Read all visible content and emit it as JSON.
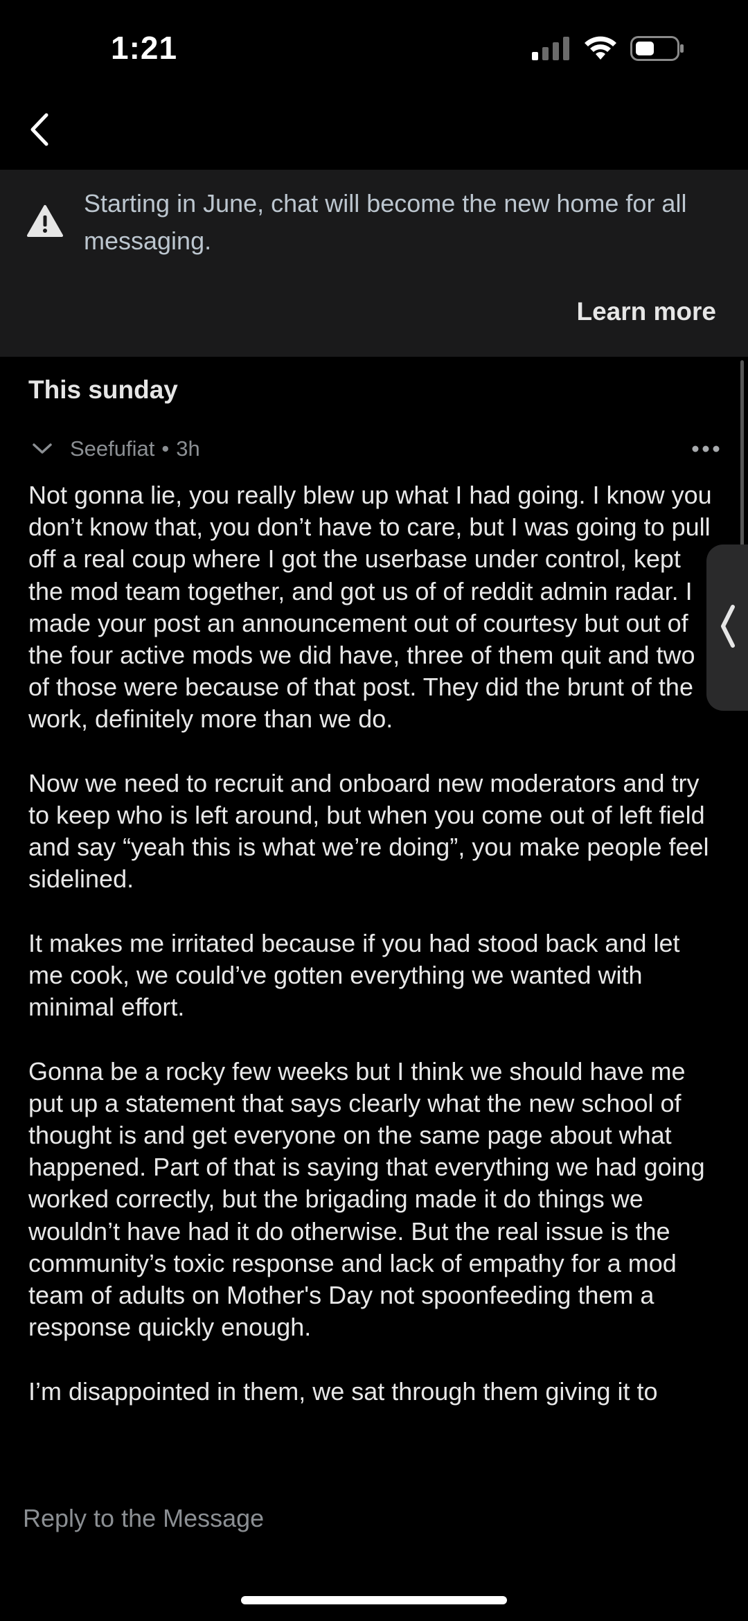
{
  "status_bar": {
    "time": "1:21",
    "icons": [
      "cellular-signal-icon",
      "wifi-icon",
      "battery-icon"
    ]
  },
  "nav": {
    "back_icon": "chevron-left-icon"
  },
  "banner": {
    "icon": "warning-icon",
    "text": "Starting in June, chat will become the new home for all messaging.",
    "link_label": "Learn more"
  },
  "thread": {
    "subject": "This sunday",
    "message": {
      "author": "Seefufiat",
      "separator": "•",
      "time_ago": "3h",
      "paragraphs": [
        "Not gonna lie, you really blew up what I had going. I know you don’t know that, you don’t have to care, but I was going to pull off a real coup where I got the userbase under control, kept the mod team together, and got us of of reddit admin radar. I made your post an announcement out of courtesy but out of the four active mods we did have, three of them quit and two of those were because of that post. They did the brunt of the work, definitely more than we do.",
        "Now we need to recruit and onboard new moderators and try to keep who is left around, but when you come out of left field and say “yeah this is what we’re doing”, you make people feel sidelined.",
        "It makes me irritated because if you had stood back and let me cook, we could’ve gotten everything we wanted with minimal effort.",
        "Gonna be a rocky few weeks but I think we should have me put up a statement that says clearly what the new school of thought is and get everyone on the same page about what happened. Part of that is saying that everything we had going worked correctly, but the brigading made it do things we wouldn’t have had it do otherwise. But the real issue is the community’s toxic response and lack of empathy for a mod team of adults on Mother's Day not spoonfeeding them a response quickly enough.",
        "I’m disappointed in them, we sat through them giving it to"
      ]
    }
  },
  "reply": {
    "placeholder": "Reply to the Message"
  },
  "colors": {
    "background": "#000000",
    "banner_bg": "#1a1a1b",
    "banner_text": "#bcc6cf",
    "meta_text": "#8b8f93",
    "body_text": "#e8e8e8"
  }
}
